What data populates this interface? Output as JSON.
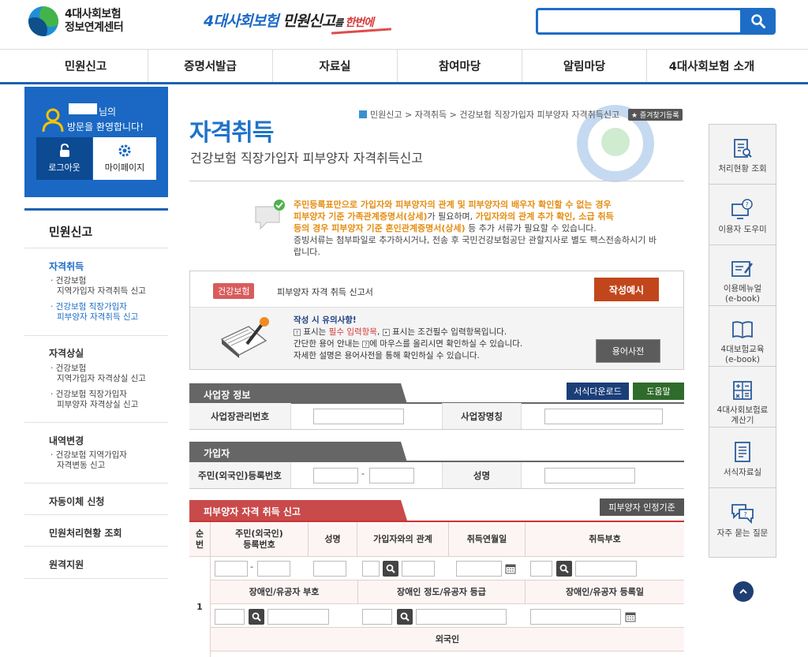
{
  "header": {
    "logo_line1": "4대사회보험",
    "logo_line2": "정보연계센터",
    "slogan_a": "4대사회보험",
    "slogan_b": " 민원신고",
    "slogan_c": "를 ",
    "slogan_d": "한번에"
  },
  "nav": [
    "민원신고",
    "증명서발급",
    "자료실",
    "참여마당",
    "알림마당",
    "4대사회보험 소개"
  ],
  "welcome": {
    "suffix": "님의",
    "text": "방문을 환영합니다!",
    "logout": "로그아웃",
    "mypage": "마이페이지"
  },
  "sidebar": {
    "title": "민원신고",
    "sec1": "자격취득",
    "sec1_sub1a": "· 건강보험",
    "sec1_sub1b": "지역가입자 자격취득 신고",
    "sec1_sub2a": "· 건강보험 직장가입자",
    "sec1_sub2b": "피부양자 자격취득 신고",
    "sec2": "자격상실",
    "sec2_sub1a": "· 건강보험",
    "sec2_sub1b": "지역가입자 자격상실 신고",
    "sec2_sub2a": "· 건강보험 직장가입자",
    "sec2_sub2b": "피부양자 자격상실 신고",
    "sec3": "내역변경",
    "sec3_sub1a": "· 건강보험 지역가입자",
    "sec3_sub1b": "자격변동 신고",
    "sec4": "자동이체 신청",
    "sec5": "민원처리현황 조회",
    "sec6": "원격지원"
  },
  "main": {
    "title": "자격취득",
    "subtitle": "건강보험 직장가입자 피부양자 자격취득신고",
    "breadcrumb": "민원신고 > 자격취득 > 건강보험 직장가입자 피부양자 자격취득신고",
    "fav": "★ 즐겨찾기등록",
    "notice1": "주민등록표만으로 가입자와 피부양자의 관계 및 피부양자의 배우자 확인할 수 없는 경우",
    "notice2": "피부양자 기준 가족관계증명서(상세)",
    "notice2b": "가 필요하며, ",
    "notice2c": "가입자와의 관계 추가 확인, 소급 취득",
    "notice3": "등의 경우 피부양자 기준 혼인관계증명서(상세)",
    "notice3b": " 등 추가 서류가 필요할 수 있습니다.",
    "notice4": "증빙서류는 첨부파일로 추가하시거나, 전송 후 국민건강보험공단 관할지사로 별도 팩스전송하시기 바",
    "notice5": "랍니다.",
    "tag": "건강보험",
    "form_name": "피부양자 자격 취득 신고서",
    "example": "작성예시",
    "caution_title": "작성 시 유의사항!",
    "caution1a": " 표시는 ",
    "caution1b": "필수 입력항목",
    "caution1c": ", ",
    "caution1d": " 표시는 조건필수 입력항목입니다.",
    "caution2a": "간단한 용어 안내는 ",
    "caution2b": "에 마우스를 올리시면 확인하실 수 있습니다.",
    "caution3": "자세한 설명은 용어사전을 통해 확인하실 수 있습니다.",
    "glossary": "용어사전",
    "sec_workplace": "사업장 정보",
    "btn_download": "서식다운로드",
    "btn_help": "도움말",
    "lbl_mgmt_no": "사업장관리번호",
    "lbl_workplace_name": "사업장명칭",
    "sec_subscriber": "가입자",
    "lbl_rrn": "주민(외국인)등록번호",
    "lbl_name": "성명",
    "dash": "-",
    "sec_dependent": "피부양자 자격 취득 신고",
    "btn_criteria": "피부양자 인정기준",
    "th_no": "순\n번",
    "th_rrn": "주민(외국인)\n등록번호",
    "th_name": "성명",
    "th_relation": "가입자와의 관계",
    "th_date": "취득연월일",
    "th_code": "취득부호",
    "th_disabled_code": "장애인/유공자 부호",
    "th_disabled_grade": "장애인 정도/유공자 등급",
    "th_disabled_date": "장애인/유공자 등록일",
    "row_no": "1",
    "th_foreigner": "외국인"
  },
  "right_sidebar": [
    {
      "label": "처리현황 조회",
      "icon": "clipboard-search-icon"
    },
    {
      "label": "이용자 도우미",
      "icon": "monitor-help-icon"
    },
    {
      "label": "이용메뉴얼\n(e-book)",
      "icon": "edit-manual-icon"
    },
    {
      "label": "4대보험교육\n(e-book)",
      "icon": "book-icon"
    },
    {
      "label": "4대사회보험료\n계산기",
      "icon": "calculator-icon"
    },
    {
      "label": "서식자료실",
      "icon": "document-icon"
    },
    {
      "label": "자주 묻는 질문",
      "icon": "faq-bubble-icon"
    }
  ],
  "colors": {
    "primary": "#1d6dc6",
    "accent_red": "#c2461c",
    "warning": "#e58d12"
  }
}
